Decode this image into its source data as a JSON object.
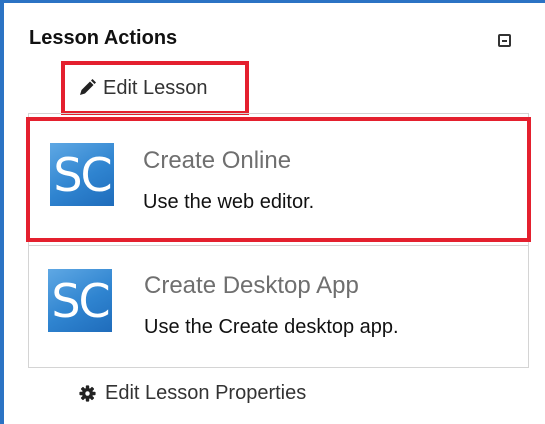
{
  "panel": {
    "title": "Lesson Actions"
  },
  "edit_lesson": {
    "label": "Edit Lesson",
    "icon": "pencil-icon"
  },
  "options": [
    {
      "logo_text": "SC",
      "title": "Create Online",
      "description": "Use the web editor."
    },
    {
      "logo_text": "SC",
      "title": "Create Desktop App",
      "description": "Use the Create desktop app."
    }
  ],
  "edit_properties": {
    "label": "Edit Lesson Properties",
    "icon": "gear-icon"
  },
  "colors": {
    "highlight": "#e4202e",
    "frame": "#2b73c4",
    "logo": "#2f84d0"
  }
}
